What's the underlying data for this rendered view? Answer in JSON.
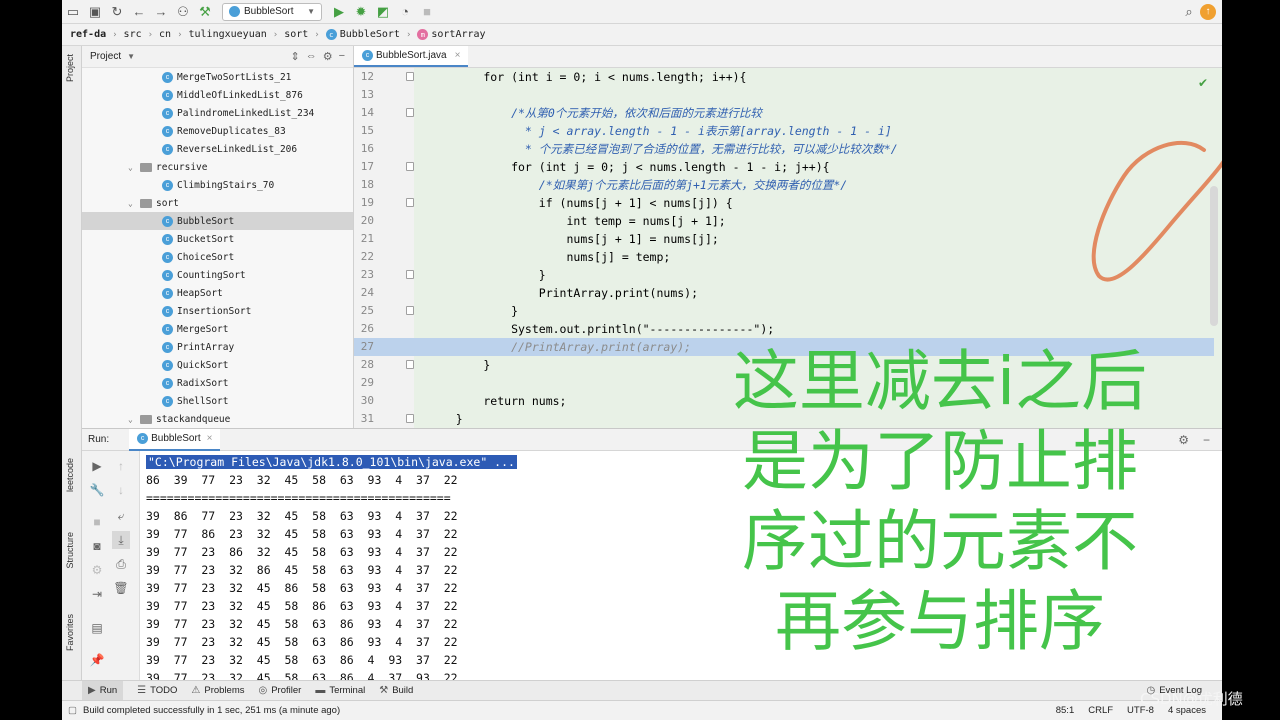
{
  "toolbar": {
    "run_config": "BubbleSort",
    "icons": [
      "folder-icon",
      "save-icon",
      "sync-icon",
      "back-icon",
      "forward-icon",
      "vcs-icon",
      "build-icon",
      "run-icon",
      "debug-icon",
      "coverage-icon",
      "profile-icon",
      "stop-icon",
      "search-icon",
      "update-icon"
    ]
  },
  "breadcrumb": [
    "ref-da",
    "src",
    "cn",
    "tulingxueyuan",
    "sort",
    "BubbleSort",
    "sortArray"
  ],
  "left_tabs": [
    "Project",
    "leetcode",
    "Structure",
    "Favorites"
  ],
  "project": {
    "title": "Project",
    "items": [
      {
        "label": "MergeTwoSortLists_21",
        "type": "class"
      },
      {
        "label": "MiddleOfLinkedList_876",
        "type": "class"
      },
      {
        "label": "PalindromeLinkedList_234",
        "type": "class"
      },
      {
        "label": "RemoveDuplicates_83",
        "type": "class"
      },
      {
        "label": "ReverseLinkedList_206",
        "type": "class"
      },
      {
        "label": "recursive",
        "type": "folder"
      },
      {
        "label": "ClimbingStairs_70",
        "type": "class"
      },
      {
        "label": "sort",
        "type": "folder"
      },
      {
        "label": "BubbleSort",
        "type": "class",
        "selected": true
      },
      {
        "label": "BucketSort",
        "type": "class"
      },
      {
        "label": "ChoiceSort",
        "type": "class"
      },
      {
        "label": "CountingSort",
        "type": "class"
      },
      {
        "label": "HeapSort",
        "type": "class"
      },
      {
        "label": "InsertionSort",
        "type": "class"
      },
      {
        "label": "MergeSort",
        "type": "class"
      },
      {
        "label": "PrintArray",
        "type": "class"
      },
      {
        "label": "QuickSort",
        "type": "class"
      },
      {
        "label": "RadixSort",
        "type": "class"
      },
      {
        "label": "ShellSort",
        "type": "class"
      },
      {
        "label": "stackandqueue",
        "type": "folder"
      }
    ]
  },
  "editor": {
    "tab": "BubbleSort.java",
    "current_line": 27,
    "lines": [
      {
        "n": "12",
        "text": "        for (int i = 0; i < nums.length; i++){"
      },
      {
        "n": "13",
        "text": ""
      },
      {
        "n": "14",
        "text": "            /*从第0个元素开始，依次和后面的元素进行比较"
      },
      {
        "n": "15",
        "text": "              * j < array.length - 1 - i表示第[array.length - 1 - i]"
      },
      {
        "n": "16",
        "text": "              * 个元素已经冒泡到了合适的位置，无需进行比较，可以减少比较次数*/"
      },
      {
        "n": "17",
        "text": "            for (int j = 0; j < nums.length - 1 - i; j++){"
      },
      {
        "n": "18",
        "text": "                /*如果第j个元素比后面的第j+1元素大，交换两者的位置*/"
      },
      {
        "n": "19",
        "text": "                if (nums[j + 1] < nums[j]) {"
      },
      {
        "n": "20",
        "text": "                    int temp = nums[j + 1];"
      },
      {
        "n": "21",
        "text": "                    nums[j + 1] = nums[j];"
      },
      {
        "n": "22",
        "text": "                    nums[j] = temp;"
      },
      {
        "n": "23",
        "text": "                }"
      },
      {
        "n": "24",
        "text": "                PrintArray.print(nums);"
      },
      {
        "n": "25",
        "text": "            }"
      },
      {
        "n": "26",
        "text": "            System.out.println(\"---------------\");"
      },
      {
        "n": "27",
        "text": "            //PrintArray.print(array);"
      },
      {
        "n": "28",
        "text": "        }"
      },
      {
        "n": "29",
        "text": ""
      },
      {
        "n": "30",
        "text": "        return nums;"
      },
      {
        "n": "31",
        "text": "    }"
      }
    ]
  },
  "run": {
    "label": "Run:",
    "tab": "BubbleSort",
    "command": "\"C:\\Program Files\\Java\\jdk1.8.0_101\\bin\\java.exe\" ...",
    "lines": [
      "86  39  77  23  32  45  58  63  93  4  37  22",
      "============================================",
      "39  86  77  23  32  45  58  63  93  4  37  22",
      "39  77  86  23  32  45  58  63  93  4  37  22",
      "39  77  23  86  32  45  58  63  93  4  37  22",
      "39  77  23  32  86  45  58  63  93  4  37  22",
      "39  77  23  32  45  86  58  63  93  4  37  22",
      "39  77  23  32  45  58  86  63  93  4  37  22",
      "39  77  23  32  45  58  63  86  93  4  37  22",
      "39  77  23  32  45  58  63  86  93  4  37  22",
      "39  77  23  32  45  58  63  86  4  93  37  22",
      "39  77  23  32  45  58  63  86  4  37  93  22"
    ]
  },
  "bottom_tabs": [
    "Run",
    "TODO",
    "Problems",
    "Profiler",
    "Terminal",
    "Build"
  ],
  "event_log": "Event Log",
  "status": {
    "message": "Build completed successfully in 1 sec, 251 ms (a minute ago)",
    "position": "85:1",
    "line_sep": "CRLF",
    "encoding": "UTF-8",
    "indent": "4 spaces"
  },
  "overlay": {
    "lines": [
      "这里减去i之后",
      "是为了防止排",
      "序过的元素不",
      "再参与排序"
    ],
    "color": "#45c44a"
  },
  "watermark": "CSDN@优利德"
}
